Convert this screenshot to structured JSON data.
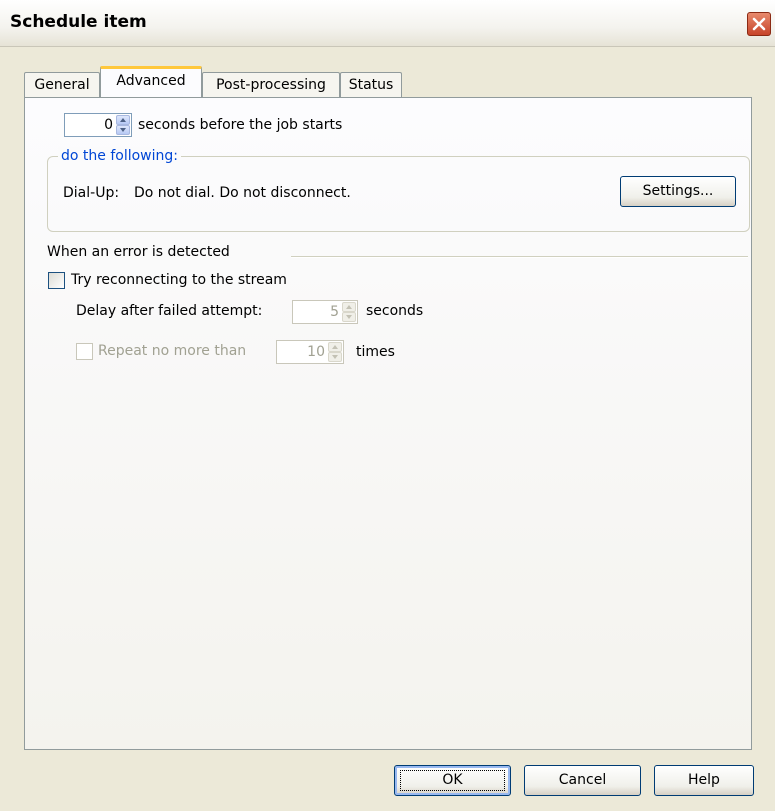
{
  "window": {
    "title": "Schedule item"
  },
  "tabs": [
    {
      "label": "General",
      "active": false
    },
    {
      "label": "Advanced",
      "active": true
    },
    {
      "label": "Post-processing",
      "active": false
    },
    {
      "label": "Status",
      "active": false
    }
  ],
  "advanced": {
    "delay_value": "0",
    "delay_label": "seconds before the job starts",
    "group_title": "do the following:",
    "dialup_label": "Dial-Up:",
    "dialup_value": "Do not dial. Do not disconnect.",
    "settings_button": "Settings...",
    "error_section_label": "When an error is detected",
    "reconnect_checkbox_label": "Try reconnecting to the stream",
    "reconnect_checked": false,
    "delay_after_label": "Delay after failed attempt:",
    "delay_after_value": "5",
    "delay_after_unit": "seconds",
    "repeat_label": "Repeat no more than",
    "repeat_value": "10",
    "repeat_unit": "times"
  },
  "footer": {
    "ok": "OK",
    "cancel": "Cancel",
    "help": "Help"
  },
  "colors": {
    "group_title": "#0046d5",
    "tab_active_accent": "#ffc83c",
    "disabled_text": "#a1a192"
  }
}
